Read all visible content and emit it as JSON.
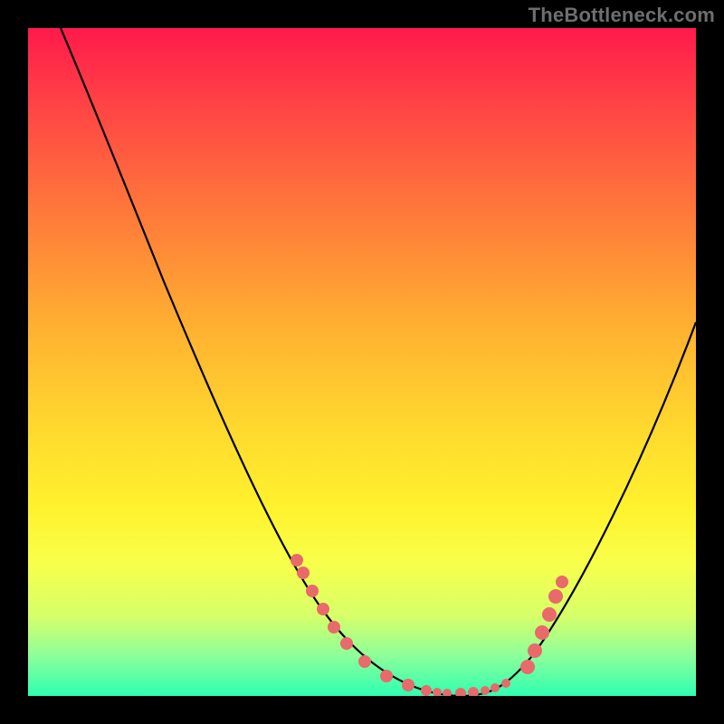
{
  "watermark": "TheBottleneck.com",
  "colors": {
    "frame": "#000000",
    "gradient_top": "#ff1a4b",
    "gradient_bottom": "#2effb0",
    "curve": "#000000",
    "dots": "#e86a6a"
  },
  "chart_data": {
    "type": "line",
    "title": "",
    "xlabel": "",
    "ylabel": "",
    "xlim": [
      0,
      100
    ],
    "ylim": [
      0,
      100
    ],
    "grid": false,
    "legend": false,
    "annotations": [
      "TheBottleneck.com"
    ],
    "series": [
      {
        "name": "curve",
        "x": [
          5,
          10,
          15,
          20,
          25,
          30,
          35,
          40,
          45,
          50,
          55,
          60,
          62,
          65,
          70,
          75,
          80,
          85,
          90,
          95,
          100
        ],
        "y": [
          100,
          92,
          83,
          74,
          65,
          56,
          47,
          38,
          29,
          20,
          11,
          4,
          1,
          0,
          0,
          2,
          8,
          18,
          30,
          43,
          56
        ]
      }
    ],
    "markers": [
      {
        "x": 40,
        "y": 20
      },
      {
        "x": 41,
        "y": 18
      },
      {
        "x": 43,
        "y": 15
      },
      {
        "x": 45,
        "y": 12
      },
      {
        "x": 47,
        "y": 9
      },
      {
        "x": 49,
        "y": 7
      },
      {
        "x": 52,
        "y": 4
      },
      {
        "x": 55,
        "y": 2
      },
      {
        "x": 58,
        "y": 1
      },
      {
        "x": 60,
        "y": 0.5
      },
      {
        "x": 62,
        "y": 0.3
      },
      {
        "x": 63,
        "y": 0.2
      },
      {
        "x": 65,
        "y": 0.2
      },
      {
        "x": 67,
        "y": 0.3
      },
      {
        "x": 69,
        "y": 0.5
      },
      {
        "x": 71,
        "y": 0.8
      },
      {
        "x": 73,
        "y": 1.3
      },
      {
        "x": 75,
        "y": 3
      },
      {
        "x": 76,
        "y": 6
      },
      {
        "x": 77,
        "y": 9
      },
      {
        "x": 78,
        "y": 12
      },
      {
        "x": 79,
        "y": 15
      },
      {
        "x": 80,
        "y": 17
      }
    ],
    "notes": "No axes, ticks, or numeric labels are rendered. y-values represent height as percent of plot area; x-values percent of width. Curve is a V-shaped bottleneck profile with minimum near x≈65."
  }
}
